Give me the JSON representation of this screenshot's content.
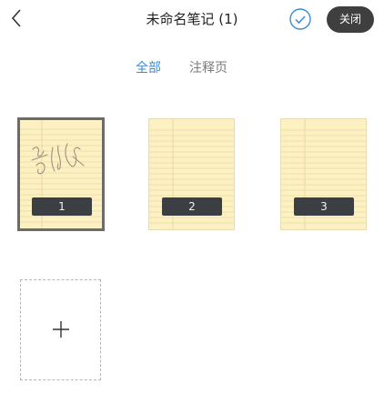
{
  "header": {
    "title": "未命名笔记 (1)",
    "close_label": "关闭",
    "back_icon": "chevron-left-icon",
    "check_icon": "check-circle-icon",
    "accent_color": "#3d8ad6"
  },
  "tabs": [
    {
      "label": "全部",
      "active": true
    },
    {
      "label": "注释页",
      "active": false
    }
  ],
  "pages": [
    {
      "number": "1",
      "selected": true,
      "has_handwriting": true
    },
    {
      "number": "2",
      "selected": false,
      "has_handwriting": false
    },
    {
      "number": "3",
      "selected": false,
      "has_handwriting": false
    }
  ],
  "add_page": {
    "icon": "plus-icon"
  }
}
